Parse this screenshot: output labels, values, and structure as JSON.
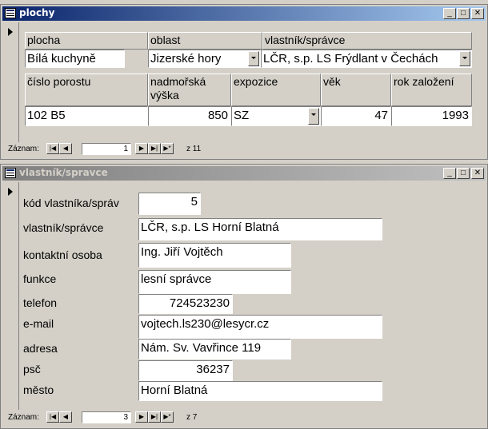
{
  "window1": {
    "title": "plochy",
    "headers": {
      "plocha": "plocha",
      "oblast": "oblast",
      "vlastnik": "vlastník/správce",
      "cislo": "číslo porostu",
      "nadmorska": "nadmořská výška",
      "expozice": "expozice",
      "vek": "věk",
      "rok": "rok založení"
    },
    "values": {
      "plocha": "Bílá kuchyně",
      "oblast": "Jizerské hory",
      "vlastnik": "LČR, s.p. LS Frýdlant v Čechách",
      "cislo": "102 B5",
      "nadmorska": "850",
      "expozice": "SZ",
      "vek": "47",
      "rok": "1993"
    },
    "nav": {
      "label": "Záznam:",
      "current": "1",
      "of": "z 11"
    }
  },
  "window2": {
    "title": "vlastník/spravce",
    "fields": {
      "kod": {
        "label": "kód vlastníka/správ",
        "value": "5"
      },
      "vlastnik": {
        "label": "vlastník/správce",
        "value": "LČR, s.p. LS Horní Blatná"
      },
      "kontakt": {
        "label": "kontaktní osoba",
        "value": "Ing. Jiří Vojtěch"
      },
      "funkce": {
        "label": "funkce",
        "value": "lesní správce"
      },
      "telefon": {
        "label": "telefon",
        "value": "724523230"
      },
      "email": {
        "label": "e-mail",
        "value": "vojtech.ls230@lesycr.cz"
      },
      "adresa": {
        "label": "adresa",
        "value": "Nám. Sv. Vavřince 119"
      },
      "psc": {
        "label": "psč",
        "value": "36237"
      },
      "mesto": {
        "label": "město",
        "value": "Horní Blatná"
      }
    },
    "nav": {
      "label": "Záznam:",
      "current": "3",
      "of": "z 7"
    }
  },
  "colors": {
    "active_title": "#0a246a",
    "inactive_title": "#808080",
    "face": "#d4d0c8"
  }
}
